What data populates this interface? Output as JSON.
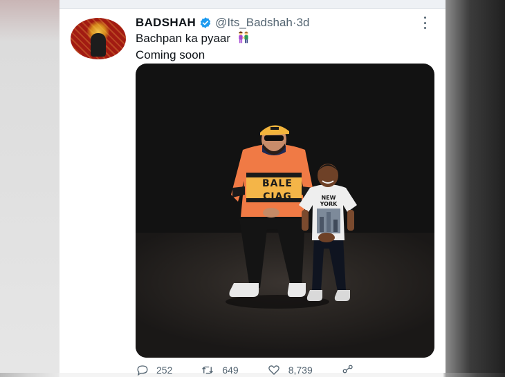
{
  "tweet": {
    "display_name": "BADSHAH",
    "handle": "@Its_Badshah",
    "separator": " · ",
    "time": "3d",
    "text_line1": "Bachpan ka pyaar",
    "text_line2": "Coming soon",
    "emoji": "girl-and-boy-holding-hands-emoji",
    "verified_color": "#1d9bf0"
  },
  "photo": {
    "shirt_text_top": "BALE",
    "shirt_text_bottom": "CIAG",
    "tee_text": "NEW YORK"
  },
  "actions": {
    "reply_count": "252",
    "retweet_count": "649",
    "like_count": "8,739"
  }
}
